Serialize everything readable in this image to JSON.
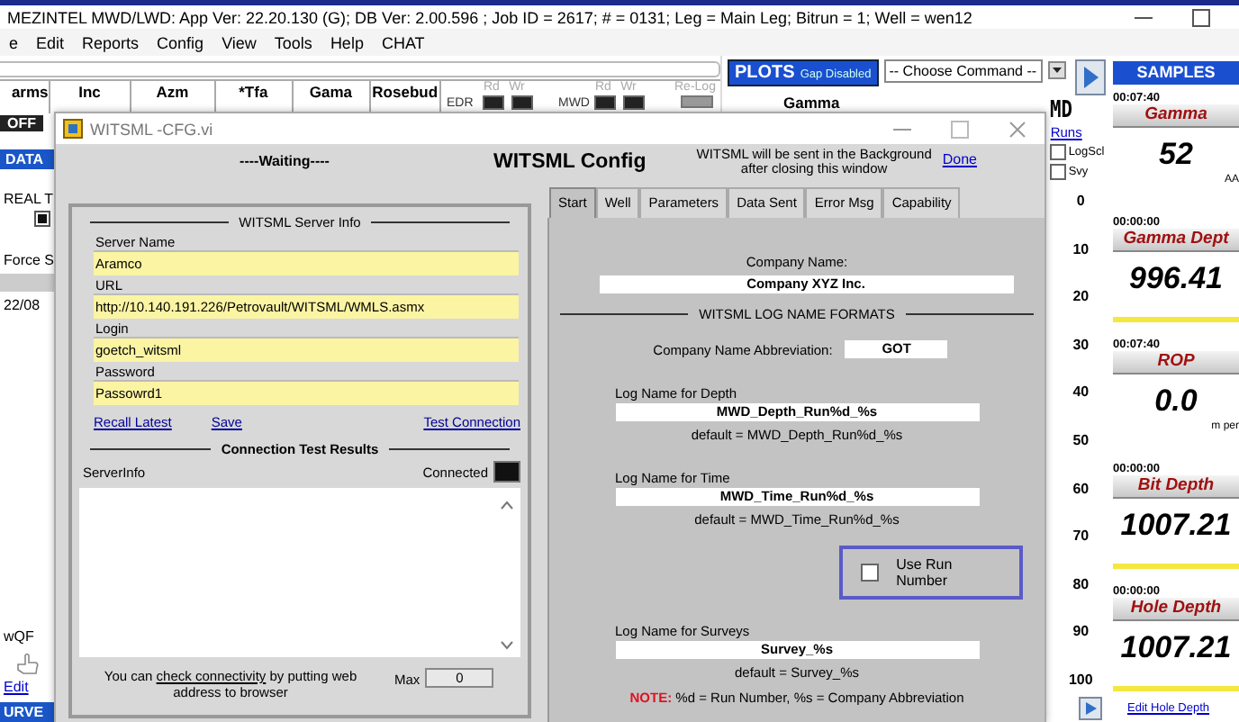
{
  "window": {
    "title": "MEZINTEL MWD/LWD: App Ver: 22.20.130 (G); DB Ver: 2.00.596 ; Job ID = 2617; # = 0131; Leg = Main Leg; Bitrun = 1; Well = wen12"
  },
  "menu": [
    "e",
    "Edit",
    "Reports",
    "Config",
    "View",
    "Tools",
    "Help",
    "CHAT"
  ],
  "grid_header": {
    "columns": [
      "arms",
      "Inc",
      "Azm",
      "*Tfa",
      "Gama",
      "Rosebud"
    ],
    "indicators": [
      {
        "label": "EDR",
        "leds": [
          {
            "label": "Rd",
            "on": false
          },
          {
            "label": "Wr",
            "on": false
          }
        ]
      },
      {
        "label": "MWD",
        "leds": [
          {
            "label": "Rd",
            "on": false
          },
          {
            "label": "Wr",
            "on": false
          }
        ]
      },
      {
        "label": "Re-Log",
        "leds": [
          {
            "on": false
          }
        ]
      }
    ]
  },
  "left_strip": {
    "off_button": "OFF",
    "data_tab": "DATA",
    "real_time": {
      "label": "REAL T",
      "checked": true
    },
    "force": "Force S",
    "date": "22/08",
    "qf": "wQF",
    "edit": "Edit",
    "survey_tab": "URVE"
  },
  "plots": {
    "button": "PLOTS",
    "gap": "Gap Disabled",
    "command": "-- Choose Command --",
    "track_title": "Gamma",
    "md": "MD",
    "runs": "Runs",
    "options": [
      {
        "label": "LogScl",
        "checked": false
      },
      {
        "label": "Svy",
        "checked": false
      }
    ],
    "depth_ticks": [
      "0",
      "10",
      "20",
      "30",
      "40",
      "50",
      "60",
      "70",
      "80",
      "90",
      "100"
    ]
  },
  "samples": {
    "title": "SAMPLES",
    "items": [
      {
        "kind": "unit",
        "time": "00:07:40",
        "name": "Gamma",
        "value": "52",
        "unit": "AA"
      },
      {
        "kind": "bar",
        "time": "00:00:00",
        "name": "Gamma Dept",
        "value": "996.41"
      },
      {
        "kind": "unit",
        "time": "00:07:40",
        "name": "ROP",
        "value": "0.0",
        "unit": "m per"
      },
      {
        "kind": "bar",
        "time": "00:00:00",
        "name": "Bit Depth",
        "value": "1007.21"
      },
      {
        "kind": "bar",
        "time": "00:00:00",
        "name": "Hole Depth",
        "value": "1007.21"
      }
    ],
    "edit_link": "Edit Hole Depth"
  },
  "dialog": {
    "title": "WITSML -CFG.vi",
    "status": "----Waiting----",
    "heading": "WITSML Config",
    "note_lines": [
      "WITSML will be sent in the Background",
      "after closing this window"
    ],
    "done": "Done",
    "server": {
      "title": "WITSML Server Info",
      "fields": [
        {
          "label": "Server Name",
          "value": "Aramco"
        },
        {
          "label": "URL",
          "value": "http://10.140.191.226/Petrovault/WITSML/WMLS.asmx"
        },
        {
          "label": "Login",
          "value": "goetch_witsml"
        },
        {
          "label": "Password",
          "value": "Passowrd1"
        }
      ],
      "links": [
        "Recall Latest",
        "Save",
        "Test Connection"
      ],
      "results_title": "Connection Test Results",
      "info_label": "ServerInfo",
      "connected_label": "Connected",
      "connected": false,
      "footer_before": "You can",
      "footer_link": "check connectivity",
      "footer_after": "by putting web address to browser",
      "max_label": "Max",
      "max_value": "0"
    },
    "tabs": [
      {
        "label": "Start",
        "selected": true
      },
      {
        "label": "Well",
        "selected": false
      },
      {
        "label": "Parameters",
        "selected": false
      },
      {
        "label": "Data Sent",
        "selected": false
      },
      {
        "label": "Error Msg",
        "selected": false
      },
      {
        "label": "Capability",
        "selected": false
      }
    ],
    "start": {
      "company_label": "Company Name:",
      "company": "Company XYZ Inc.",
      "formats_title": "WITSML LOG NAME FORMATS",
      "abbr_label": "Company Name Abbreviation:",
      "abbr": "GOT",
      "items": [
        {
          "kind": "log",
          "label": "Log Name for Depth",
          "value": "MWD_Depth_Run%d_%s",
          "default": "default = MWD_Depth_Run%d_%s"
        },
        {
          "kind": "log",
          "label": "Log Name for Time",
          "value": "MWD_Time_Run%d_%s",
          "default": "default = MWD_Time_Run%d_%s"
        },
        {
          "kind": "checkbox",
          "label": "Use Run Number",
          "checked": false
        },
        {
          "kind": "log",
          "label": "Log Name for Surveys",
          "value": "Survey_%s",
          "default": "default = Survey_%s"
        }
      ],
      "note_label": "NOTE:",
      "note": "%d = Run Number, %s = Company Abbreviation"
    }
  }
}
